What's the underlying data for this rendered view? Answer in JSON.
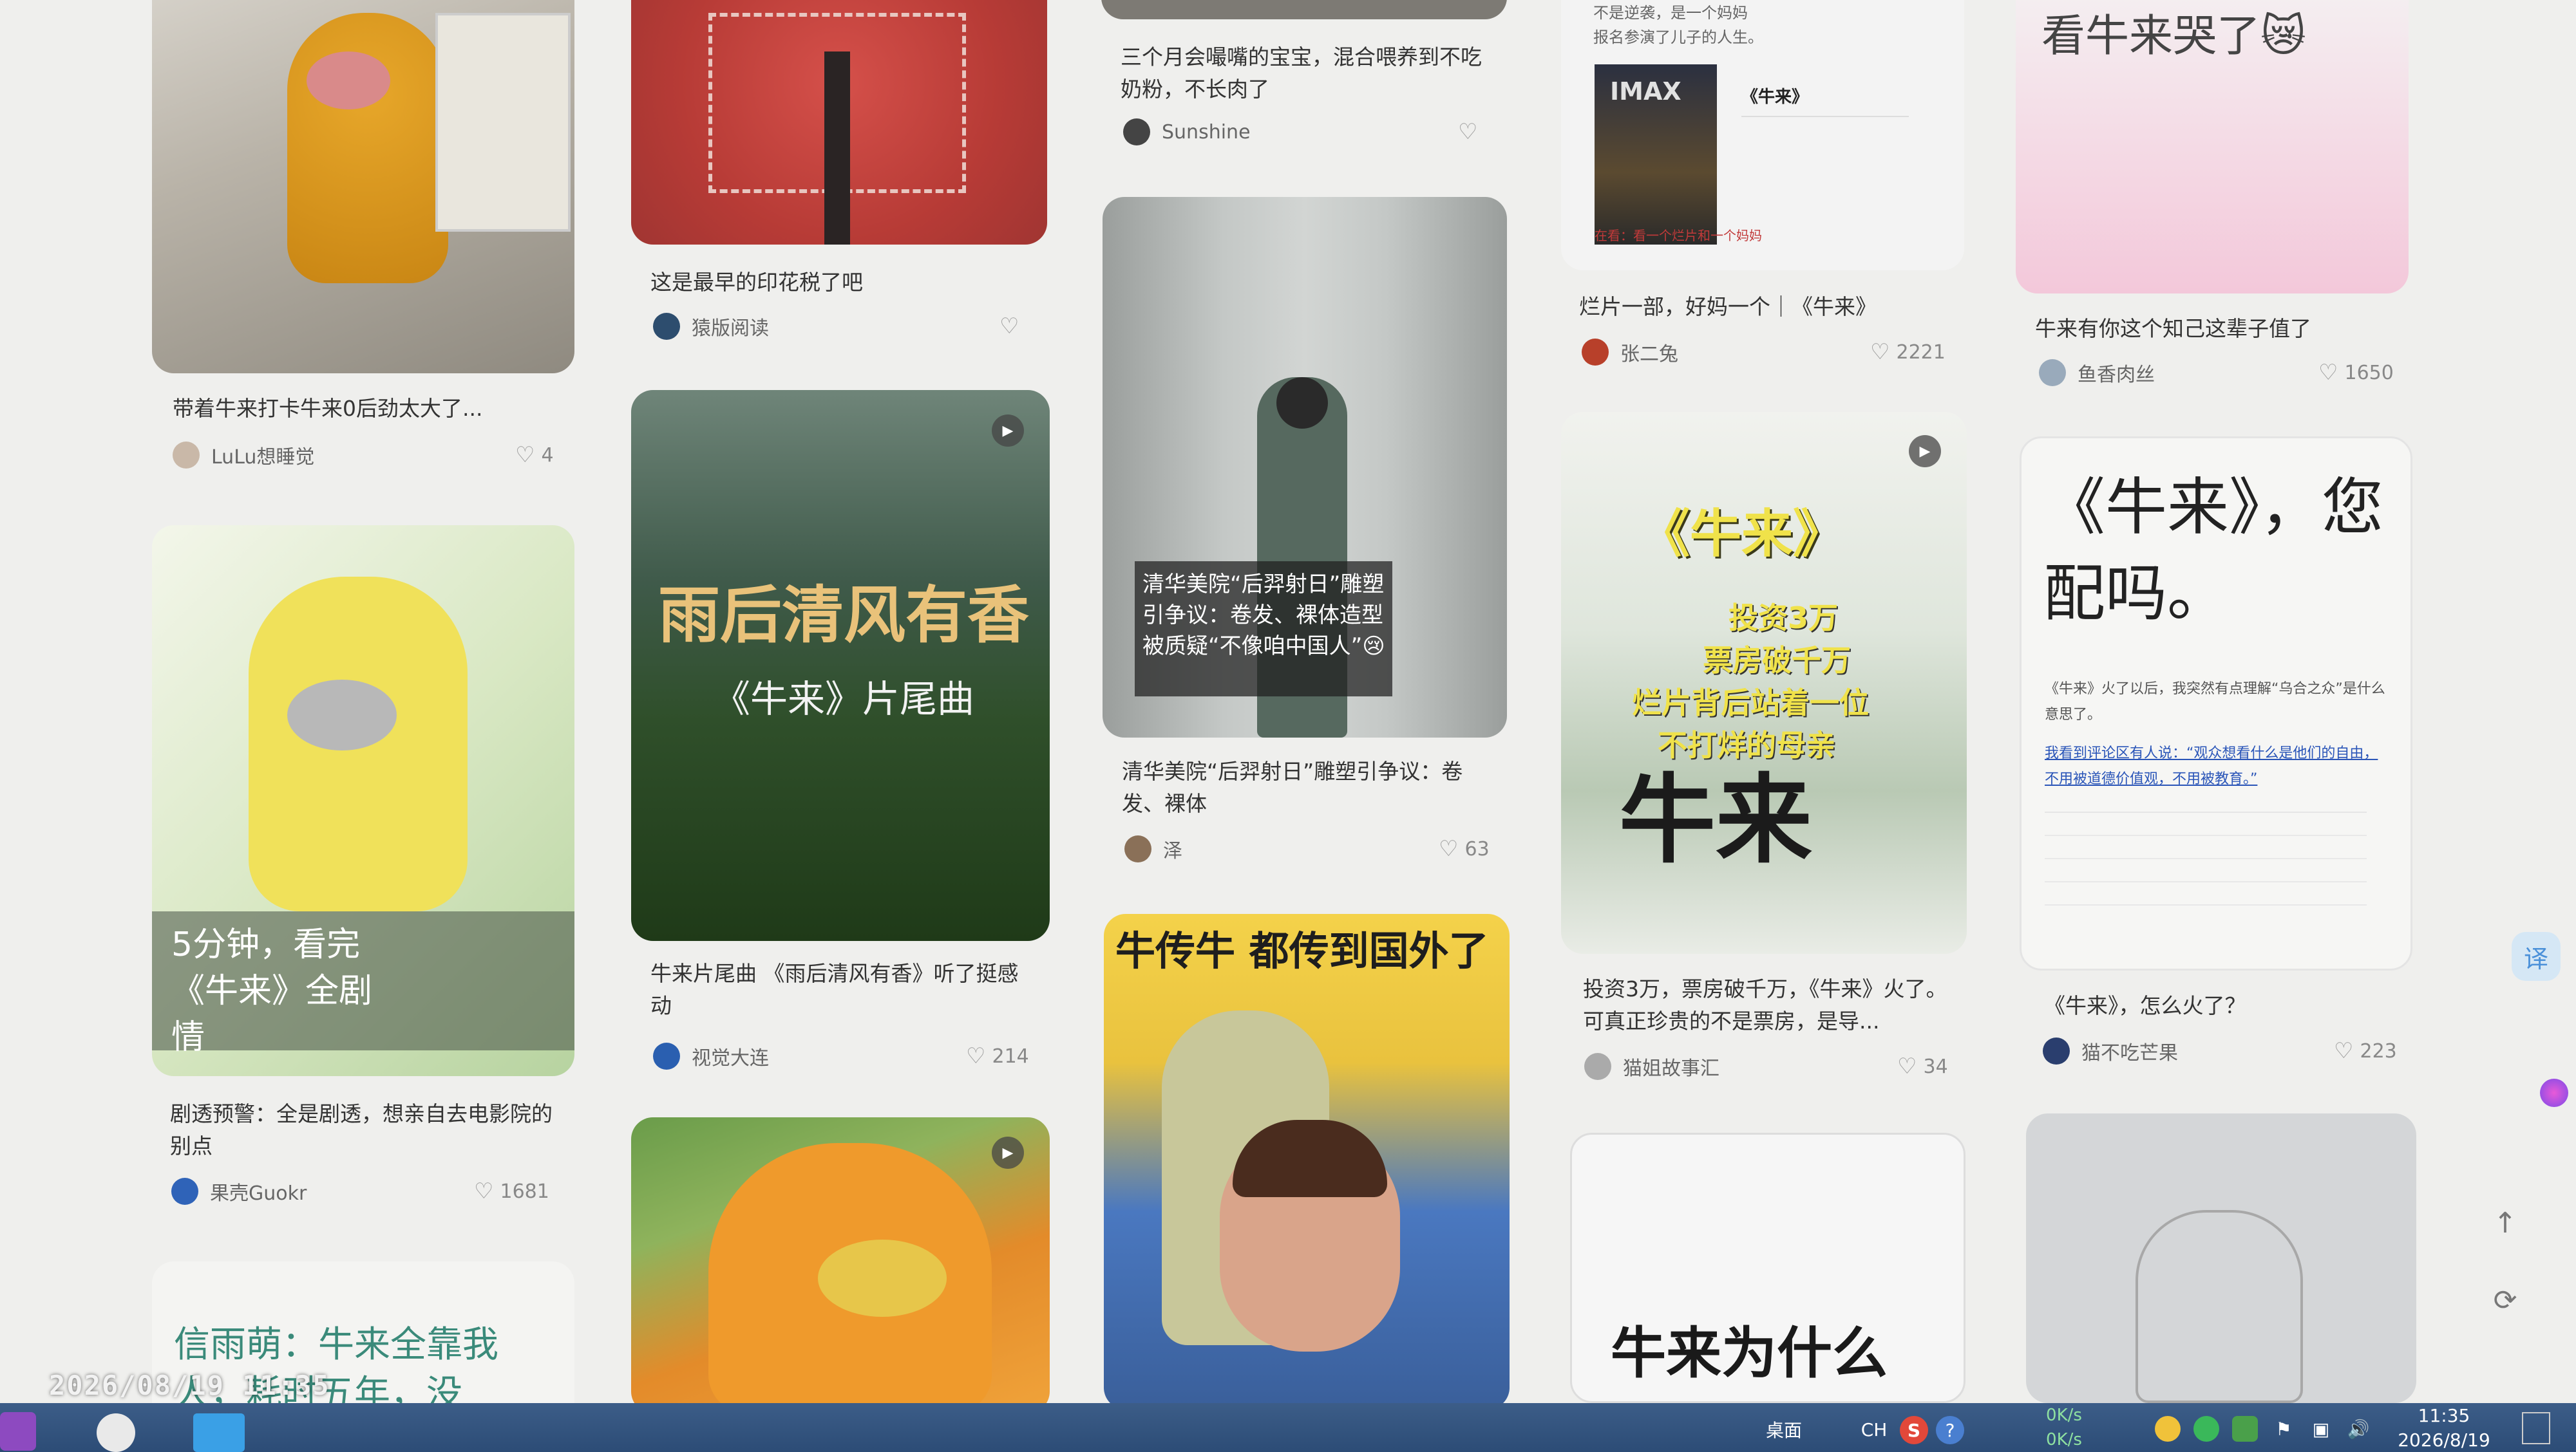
{
  "colors": {
    "bg": "#efefed",
    "taskbar": "#2f5079",
    "heart": "#999999",
    "accent": "#4a90d9"
  },
  "cards": [
    {
      "caption": "带着牛来打卡牛来0后劲太大了...",
      "author": "LuLu想睡觉",
      "likes": "4"
    },
    {
      "caption": "剧透预警：全是剧透，想亲自去电影院的别点",
      "author": "果壳Guokr",
      "likes": "1681",
      "overlay": "5分钟，看完《牛来》全剧情"
    },
    {
      "overlay": "信雨萌：牛来全靠我人，耗时五年，没"
    },
    {
      "caption": "这是最早的印花税了吧",
      "author": "猿版阅读",
      "likes": ""
    },
    {
      "caption": "牛来片尾曲 《雨后清风有香》听了挺感动",
      "author": "视觉大连",
      "likes": "214",
      "overlay_title": "雨后清风有香",
      "overlay_sub": "《牛来》片尾曲"
    },
    {
      "caption": "三个月会嘬嘴的宝宝，混合喂养到不吃奶粉，不长肉了",
      "author": "Sunshine",
      "likes": ""
    },
    {
      "caption": "清华美院“后羿射日”雕塑引争议：卷发、裸体",
      "author": "泽",
      "likes": "63",
      "overlay": "清华美院“后羿射日”雕塑引争议：卷发、裸体造型被质疑“不像咱中国人”😢"
    },
    {
      "overlay": "牛传牛 都传到国外了"
    },
    {
      "caption": "烂片一部，好妈一个｜《牛来》",
      "author": "张二兔",
      "likes": "2221",
      "poster_top": "不是逆袭，是一个妈妈",
      "poster_top2": "报名参演了儿子的人生。",
      "poster_title": "《牛来》",
      "poster_brand": "IMAX",
      "poster_tag": "在看：看一个烂片和一个妈妈"
    },
    {
      "caption": "投资3万，票房破千万，《牛来》火了。可真正珍贵的不是票房，是导...",
      "author": "猫姐故事汇",
      "likes": "34",
      "ink_title": "《牛来》",
      "ink_lines": [
        "投资3万",
        "票房破千万",
        "烂片背后站着一位",
        "不打烊的母亲"
      ],
      "ink_big": "牛来"
    },
    {
      "overlay": "牛来为什么"
    },
    {
      "caption": "牛来有你这个知己这辈子值了",
      "author": "鱼香肉丝",
      "likes": "1650",
      "overlay": "看牛来哭了😿"
    },
    {
      "caption": "《牛来》，怎么火了？",
      "author": "猫不吃芒果",
      "likes": "223",
      "big_title": "《牛来》，您配吗。",
      "body1": "《牛来》火了以后，我突然有点理解“乌合之众”是什么意思了。",
      "body2": "我看到评论区有人说：“观众想看什么是他们的自由，不用被道德价值观，不用被教育。”"
    }
  ],
  "taskbar": {
    "desktop": "桌面",
    "lang": "CH",
    "net_up": "0K/s",
    "net_down": "0K/s",
    "time": "11:35",
    "date": "2026/8/19"
  },
  "timestamp": "2026/08/19 11:35",
  "side": {
    "translate": "译"
  }
}
